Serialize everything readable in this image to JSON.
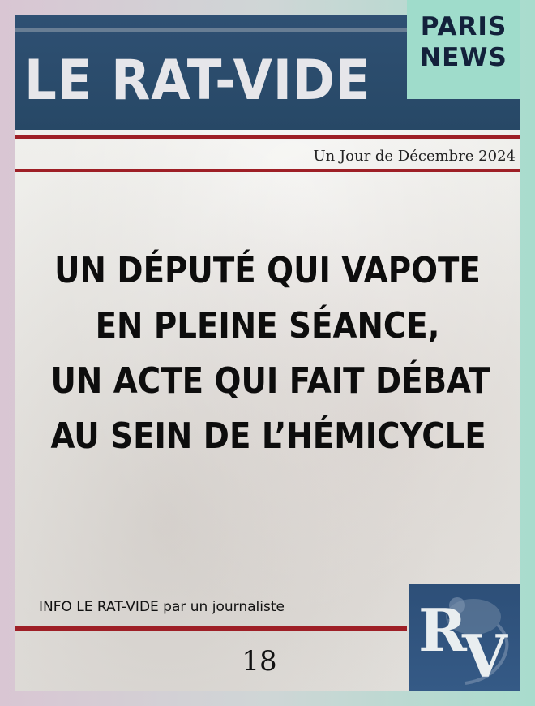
{
  "masthead": {
    "title": "LE RAT-VIDE",
    "paris_line1": "PARIS",
    "paris_line2": "NEWS"
  },
  "date": "Un Jour de Décembre 2024",
  "headline": {
    "lines": [
      "UN DÉPUTÉ QUI VAPOTE",
      "EN PLEINE SÉANCE,",
      "UN ACTE QUI FAIT DÉBAT",
      "AU SEIN DE L’HÉMICYCLE"
    ]
  },
  "byline": "INFO LE RAT-VIDE par un journaliste",
  "page_number": "18",
  "logo": {
    "letter1": "R",
    "letter2": "V",
    "icon": "rat-logo-icon"
  },
  "colors": {
    "masthead_blue": "#2f5073",
    "accent_mint": "#9fdccb",
    "rule_red": "#9e1f26",
    "headline_black": "#0d0d0d"
  }
}
